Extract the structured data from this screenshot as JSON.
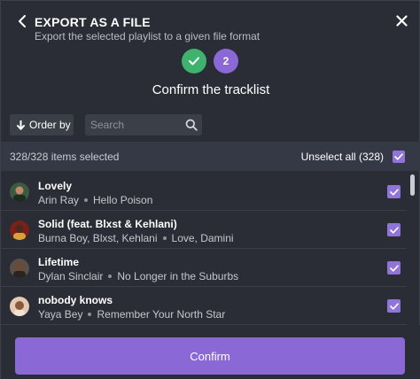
{
  "header": {
    "title": "EXPORT AS A FILE",
    "subtitle": "Export the selected playlist to a given file format"
  },
  "steps": {
    "step1_icon": "check-icon",
    "step2_label": "2"
  },
  "heading": "Confirm the tracklist",
  "toolbar": {
    "order_label": "Order by",
    "search_placeholder": "Search"
  },
  "selection": {
    "count_text": "328/328 items selected",
    "unselect_label": "Unselect all (328)"
  },
  "tracks": [
    {
      "title": "Lovely",
      "artist": "Arin Ray",
      "album": "Hello Poison",
      "selected": true
    },
    {
      "title": "Solid (feat. Blxst & Kehlani)",
      "artist": "Burna Boy, Blxst, Kehlani",
      "album": "Love, Damini",
      "selected": true
    },
    {
      "title": "Lifetime",
      "artist": "Dylan Sinclair",
      "album": "No Longer in the Suburbs",
      "selected": true
    },
    {
      "title": "nobody knows",
      "artist": "Yaya Bey",
      "album": "Remember Your North Star",
      "selected": true
    }
  ],
  "footer": {
    "confirm_label": "Confirm"
  },
  "colors": {
    "background": "#2a2d35",
    "accent": "#8a68d6",
    "success": "#3fb26d",
    "checkbox": "#9074d8"
  }
}
